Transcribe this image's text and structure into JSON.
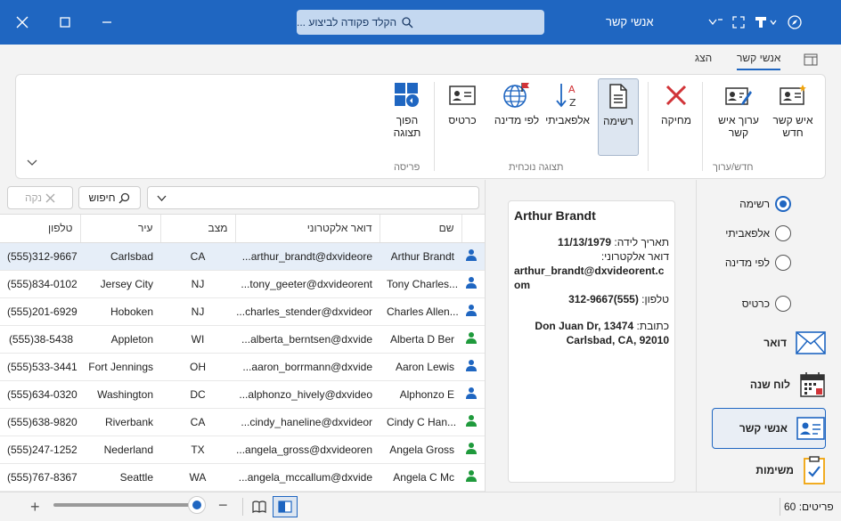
{
  "titlebar": {
    "title": "אנשי קשר",
    "search_placeholder": "הקלד פקודה לביצוע ..."
  },
  "tabs": [
    {
      "label": "אנשי קשר",
      "active": true
    },
    {
      "label": "הצג",
      "active": false
    }
  ],
  "ribbon": {
    "groups": {
      "new_edit": "חדש/ערוך",
      "current_view": "תצוגה נוכחית",
      "layout": "פריסה"
    },
    "buttons": {
      "new_contact": "איש קשר חדש",
      "edit_contact": "ערוך איש קשר",
      "delete": "מחיקה",
      "list": "רשימה",
      "alphabetical": "אלפאביתי",
      "by_state": "לפי מדינה",
      "card": "כרטיס",
      "flip_layout": "הפוך תצוגה"
    }
  },
  "find": {
    "search_label": "חיפוש",
    "clear_label": "נקה"
  },
  "grid": {
    "columns": [
      "שם",
      "דואר אלקטרוני",
      "מצב",
      "עיר",
      "טלפון"
    ],
    "rows": [
      {
        "name": "Arthur Brandt",
        "email": "arthur_brandt@dxvideore...",
        "state": "CA",
        "city": "Carlsbad",
        "phone": "(555)312-9667",
        "icon": "person-blue",
        "selected": true
      },
      {
        "name": "Tony Charles...",
        "email": "tony_geeter@dxvideorent...",
        "state": "NJ",
        "city": "Jersey City",
        "phone": "(555)834-0102",
        "icon": "person-blue",
        "selected": false
      },
      {
        "name": "Charles Allen...",
        "email": "charles_stender@dxvideor...",
        "state": "NJ",
        "city": "Hoboken",
        "phone": "(555)201-6929",
        "icon": "person-blue",
        "selected": false
      },
      {
        "name": "Alberta D Ber",
        "email": "alberta_berntsen@dxvide...",
        "state": "WI",
        "city": "Appleton",
        "phone": "(555)38-5438",
        "icon": "person-green",
        "selected": false
      },
      {
        "name": "Aaron Lewis",
        "email": "aaron_borrmann@dxvide...",
        "state": "OH",
        "city": "Fort Jennings",
        "phone": "(555)533-3441",
        "icon": "person-blue",
        "selected": false
      },
      {
        "name": "Alphonzo E",
        "email": "alphonzo_hively@dxvideo...",
        "state": "DC",
        "city": "Washington",
        "phone": "(555)634-0320",
        "icon": "person-blue",
        "selected": false
      },
      {
        "name": "Cindy C Han...",
        "email": "cindy_haneline@dxvideor...",
        "state": "CA",
        "city": "Riverbank",
        "phone": "(555)638-9820",
        "icon": "person-green",
        "selected": false
      },
      {
        "name": "Angela Gross",
        "email": "angela_gross@dxvideoren...",
        "state": "TX",
        "city": "Nederland",
        "phone": "(555)247-1252",
        "icon": "person-green",
        "selected": false
      },
      {
        "name": "Angela C Mc",
        "email": "angela_mccallum@dxvide...",
        "state": "WA",
        "city": "Seattle",
        "phone": "(555)767-8367",
        "icon": "person-green",
        "selected": false
      }
    ]
  },
  "card": {
    "name": "Arthur Brandt",
    "birthdate_label": "תאריך לידה:",
    "birthdate": "11/13/1979",
    "email_label": "דואר אלקטרוני:",
    "email": "arthur_brandt@dxvideorent.com",
    "phone_label": "טלפון:",
    "phone": "(555)312-9667",
    "address_label": "כתובת:",
    "address": "13474 Don Juan Dr, Carlsbad, CA, 92010"
  },
  "views": [
    {
      "label": "רשימה",
      "checked": true
    },
    {
      "label": "אלפאביתי",
      "checked": false
    },
    {
      "label": "לפי מדינה",
      "checked": false
    },
    {
      "label": "כרטיס",
      "checked": false
    }
  ],
  "nav": [
    {
      "label": "דואר",
      "icon": "mail-icon"
    },
    {
      "label": "לוח שנה",
      "icon": "calendar-icon"
    },
    {
      "label": "אנשי קשר",
      "icon": "contacts-icon",
      "active": true
    },
    {
      "label": "משימות",
      "icon": "tasks-icon"
    }
  ],
  "status": {
    "items_label": "פריטים:",
    "items_count": "60"
  },
  "colors": {
    "accent": "#1f66c1",
    "person_blue": "#1f66c1",
    "person_green": "#1f9a3c",
    "delete_red": "#d13438"
  }
}
